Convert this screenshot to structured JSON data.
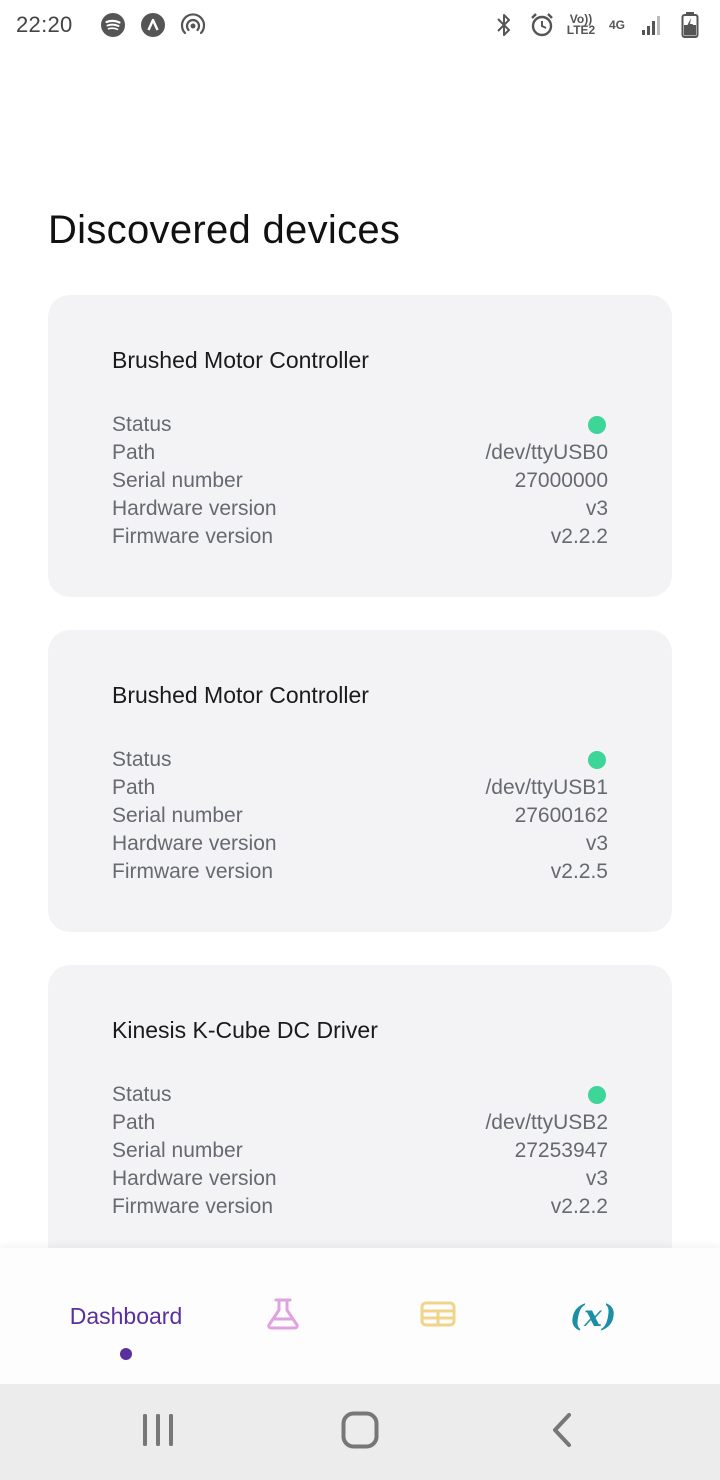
{
  "status_bar": {
    "time": "22:20",
    "left_icons": [
      "spotify-icon",
      "app-a-icon",
      "hotspot-icon"
    ],
    "right_icons": [
      "bluetooth-icon",
      "alarm-icon",
      "volte-icon",
      "4g-icon",
      "signal-icon",
      "battery-charging-icon"
    ],
    "volte_label": "Vo)) LTE2",
    "network_label": "4G"
  },
  "page_title": "Discovered devices",
  "labels": {
    "status": "Status",
    "path": "Path",
    "serial": "Serial number",
    "hardware": "Hardware version",
    "firmware": "Firmware version"
  },
  "devices": [
    {
      "name": "Brushed Motor Controller",
      "status": "online",
      "path": "/dev/ttyUSB0",
      "serial": "27000000",
      "hardware": "v3",
      "firmware": "v2.2.2"
    },
    {
      "name": "Brushed Motor Controller",
      "status": "online",
      "path": "/dev/ttyUSB1",
      "serial": "27600162",
      "hardware": "v3",
      "firmware": "v2.2.5"
    },
    {
      "name": "Kinesis K-Cube  DC Driver",
      "status": "online",
      "path": "/dev/ttyUSB2",
      "serial": "27253947",
      "hardware": "v3",
      "firmware": "v2.2.2"
    }
  ],
  "status_color": "#3dd598",
  "bottom_nav": {
    "items": [
      {
        "label": "Dashboard",
        "icon": "dashboard",
        "active": true
      },
      {
        "label": "",
        "icon": "flask-icon",
        "active": false
      },
      {
        "label": "",
        "icon": "table-icon",
        "active": false
      },
      {
        "label": "(x)",
        "icon": "variable-icon",
        "active": false
      }
    ],
    "active_color": "#5b2f9e",
    "flask_color": "#e0a3df",
    "table_color": "#f0d48a",
    "variable_color": "#1b8fa6"
  },
  "system_nav": [
    "recent-apps-icon",
    "home-icon",
    "back-icon"
  ]
}
